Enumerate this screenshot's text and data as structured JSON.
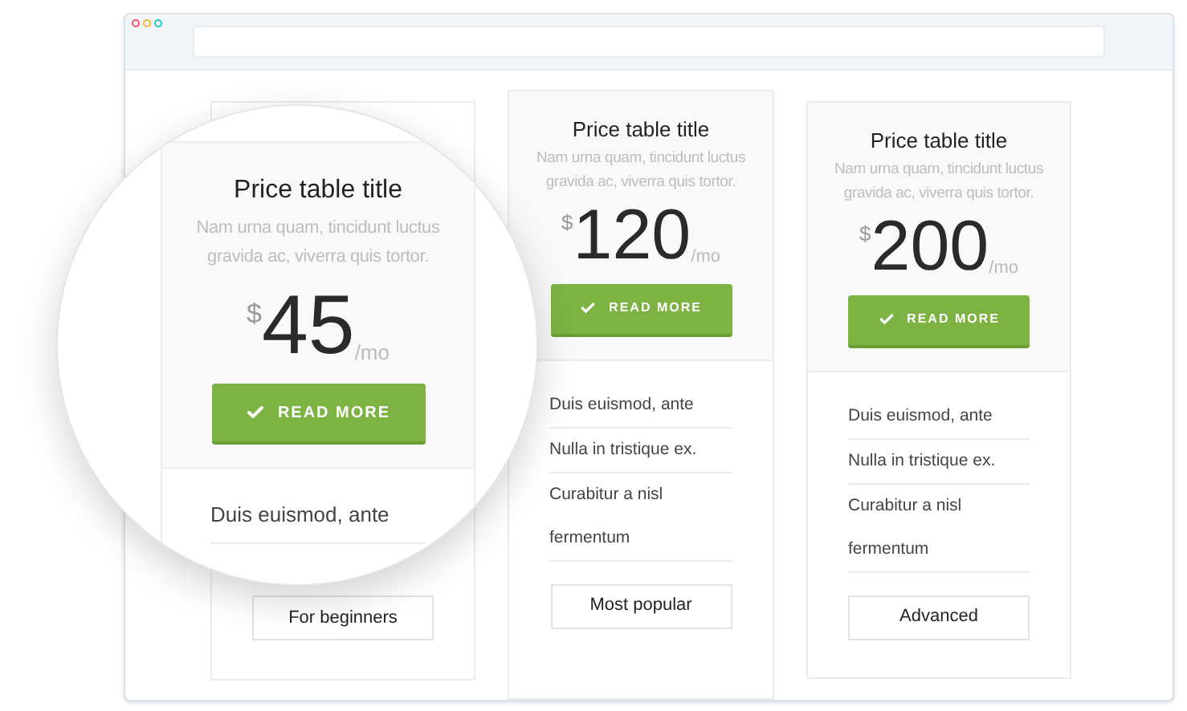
{
  "window": {
    "dots": [
      {
        "color": "#f0506e"
      },
      {
        "color": "#f5b82e"
      },
      {
        "color": "#22c3c3"
      }
    ]
  },
  "cards": [
    {
      "plan": "For beginners"
    },
    {
      "title": "Price table title",
      "description": "Nam urna quam, tincidunt luctus gravida ac, viverra quis tortor.",
      "currency": "$",
      "amount": "120",
      "period": "/mo",
      "button": "READ MORE",
      "features": [
        "Duis euismod, ante",
        "Nulla in tristique ex.",
        "Curabitur a nisl fermentum"
      ],
      "plan": "Most popular"
    },
    {
      "title": "Price table title",
      "description": "Nam urna quam, tincidunt luctus gravida ac, viverra quis tortor.",
      "currency": "$",
      "amount": "200",
      "period": "/mo",
      "button": "READ MORE",
      "features": [
        "Duis euismod, ante",
        "Nulla in tristique ex.",
        "Curabitur a nisl fermentum"
      ],
      "plan": "Advanced"
    }
  ],
  "magnifier": {
    "title": "Price table title",
    "description": "Nam urna quam, tincidunt luctus gravida ac, viverra quis tortor.",
    "currency": "$",
    "amount": "45",
    "period": "/mo",
    "button": "READ MORE",
    "features": [
      "Duis euismod, ante"
    ]
  }
}
